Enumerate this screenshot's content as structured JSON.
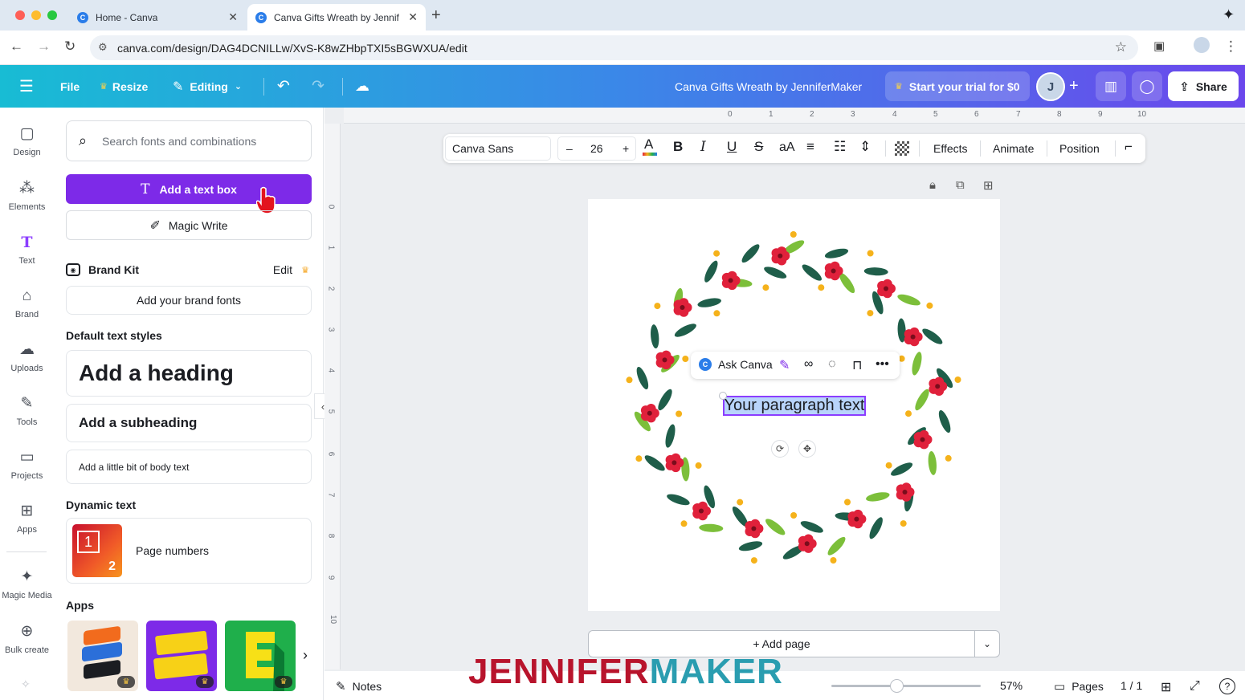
{
  "browser": {
    "tabs": [
      {
        "title": "Home - Canva",
        "close": "✕"
      },
      {
        "title": "Canva Gifts Wreath by Jennif",
        "close": "✕"
      }
    ],
    "url": "canva.com/design/DAG4DCNILLw/XvS-K8wZHbpTXI5sBGWXUA/edit"
  },
  "header": {
    "file": "File",
    "resize": "Resize",
    "editing": "Editing",
    "title": "Canva Gifts Wreath by JenniferMaker",
    "trial": "Start your trial for $0",
    "share": "Share"
  },
  "rail": {
    "items": [
      {
        "label": "Design",
        "icon": "▢"
      },
      {
        "label": "Elements",
        "icon": "⁂"
      },
      {
        "label": "Text",
        "icon": "T"
      },
      {
        "label": "Brand",
        "icon": "⌂"
      },
      {
        "label": "Uploads",
        "icon": "☁"
      },
      {
        "label": "Tools",
        "icon": "✎"
      },
      {
        "label": "Projects",
        "icon": "▭"
      },
      {
        "label": "Apps",
        "icon": "⊞"
      },
      {
        "label": "Magic Media",
        "icon": "✦"
      },
      {
        "label": "Bulk create",
        "icon": "⊕"
      }
    ]
  },
  "panel": {
    "search_placeholder": "Search fonts and combinations",
    "add_text_box": "Add a text box",
    "magic_write": "Magic Write",
    "brand_kit": "Brand Kit",
    "edit": "Edit",
    "add_brand_fonts": "Add your brand fonts",
    "default_styles": "Default text styles",
    "heading": "Add a heading",
    "subheading": "Add a subheading",
    "body": "Add a little bit of body text",
    "dynamic_text": "Dynamic text",
    "page_numbers": "Page numbers",
    "thumb_one": "1",
    "thumb_two": "2",
    "apps": "Apps"
  },
  "toolbar": {
    "font": "Canva Sans",
    "minus": "–",
    "size": "26",
    "plus": "+",
    "case": "aA",
    "effects": "Effects",
    "animate": "Animate",
    "position": "Position"
  },
  "canvas": {
    "ask_canva": "Ask Canva",
    "paragraph": "Your paragraph text",
    "add_page": "+ Add page"
  },
  "footer": {
    "notes": "Notes",
    "zoom": "57%",
    "zoom_level": 0.57,
    "pages": "Pages",
    "page_count": "1 / 1"
  },
  "watermark": {
    "part1": "JENNIFER",
    "part2": "MAKER"
  },
  "ruler": {
    "top": [
      "0",
      "1",
      "2",
      "3",
      "4",
      "5",
      "6",
      "7",
      "8",
      "9",
      "10"
    ],
    "left": [
      "0",
      "1",
      "2",
      "3",
      "4",
      "5",
      "6",
      "7",
      "8",
      "9",
      "10"
    ]
  },
  "colors": {
    "accent": "#7d2ae8",
    "header_start": "#18bcd4",
    "header_end": "#6b47ec",
    "wreath_leaf_dark": "#1f5e4a",
    "wreath_leaf_light": "#7cbf3a",
    "wreath_flower": "#e0213b",
    "wreath_berry": "#f5b21b",
    "watermark_red": "#b8142c",
    "watermark_teal": "#2a9db0"
  }
}
